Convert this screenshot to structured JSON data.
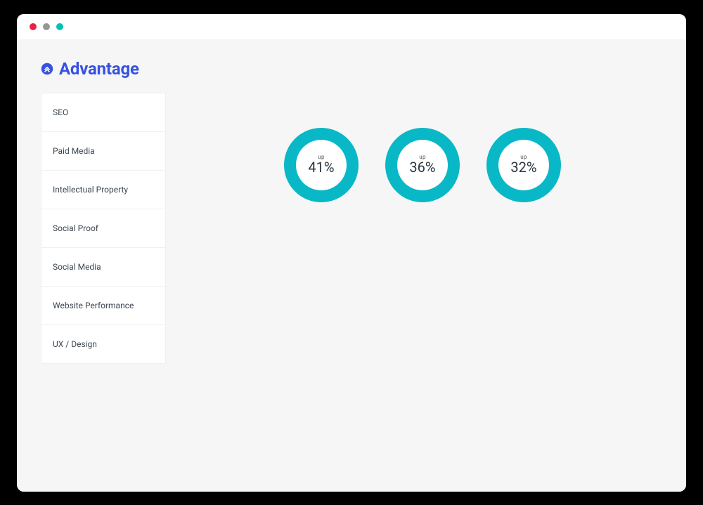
{
  "colors": {
    "accent": "#3751e0",
    "donut": "#08b8c6",
    "dot_red": "#ec2045",
    "dot_grey": "#969696",
    "dot_green": "#00c2b2"
  },
  "page": {
    "title": "Advantage"
  },
  "sidebar": {
    "items": [
      {
        "label": "SEO"
      },
      {
        "label": "Paid Media"
      },
      {
        "label": "Intellectual Property"
      },
      {
        "label": "Social Proof"
      },
      {
        "label": "Social Media"
      },
      {
        "label": "Website Performance"
      },
      {
        "label": "UX / Design"
      }
    ]
  },
  "chart_data": [
    {
      "type": "donut",
      "direction": "up",
      "value": 41,
      "display": "41%",
      "fill_percent": 100
    },
    {
      "type": "donut",
      "direction": "up",
      "value": 36,
      "display": "36%",
      "fill_percent": 100
    },
    {
      "type": "donut",
      "direction": "up",
      "value": 32,
      "display": "32%",
      "fill_percent": 100
    }
  ]
}
